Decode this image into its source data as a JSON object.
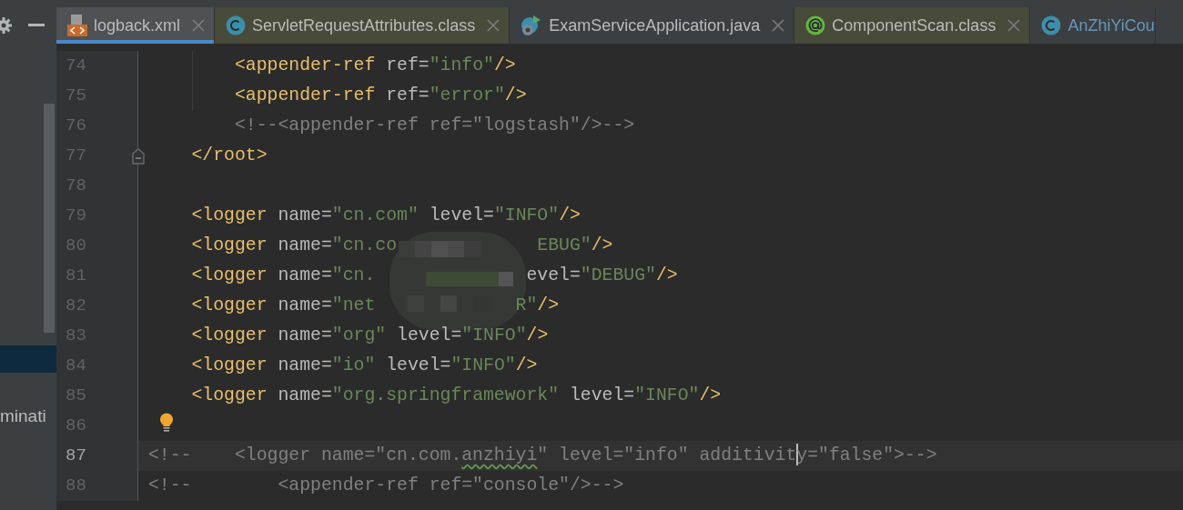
{
  "side_panel": {
    "selected_row": true,
    "label": "minati"
  },
  "tabs": [
    {
      "label": "logback.xml",
      "kind": "xml",
      "selected": true,
      "external": false,
      "vcs_modified": false
    },
    {
      "label": "ServletRequestAttributes.class",
      "kind": "class",
      "selected": false,
      "external": true,
      "vcs_modified": false
    },
    {
      "label": "ExamServiceApplication.java",
      "kind": "spring",
      "selected": false,
      "external": false,
      "vcs_modified": false
    },
    {
      "label": "ComponentScan.class",
      "kind": "annotation",
      "selected": false,
      "external": true,
      "vcs_modified": false
    },
    {
      "label": "AnZhiYiCou",
      "kind": "class",
      "selected": false,
      "external": false,
      "vcs_modified": true
    }
  ],
  "lines": [
    {
      "number": "74",
      "current": false,
      "guide": true,
      "tokens": [
        {
          "kind": "tag",
          "text": "        <appender-ref"
        },
        {
          "kind": "attr",
          "text": " ref="
        },
        {
          "kind": "str",
          "text": "\"info\""
        },
        {
          "kind": "tag",
          "text": "/>"
        }
      ]
    },
    {
      "number": "75",
      "current": false,
      "guide": true,
      "tokens": [
        {
          "kind": "tag",
          "text": "        <appender-ref"
        },
        {
          "kind": "attr",
          "text": " ref="
        },
        {
          "kind": "str",
          "text": "\"error\""
        },
        {
          "kind": "tag",
          "text": "/>"
        }
      ]
    },
    {
      "number": "76",
      "current": false,
      "tokens": [
        {
          "kind": "comment",
          "text": "        <!--<appender-ref ref=\"logstash\"/>-->"
        }
      ]
    },
    {
      "number": "77",
      "current": false,
      "fold_marker": true,
      "tokens": [
        {
          "kind": "tag",
          "text": "    </root>"
        }
      ]
    },
    {
      "number": "78",
      "current": false
    },
    {
      "number": "79",
      "current": false,
      "tokens": [
        {
          "kind": "tag",
          "text": "    <logger"
        },
        {
          "kind": "attr",
          "text": " name="
        },
        {
          "kind": "str",
          "text": "\"cn.com\""
        },
        {
          "kind": "attr",
          "text": " level="
        },
        {
          "kind": "str",
          "text": "\"INFO\""
        },
        {
          "kind": "tag",
          "text": "/>"
        }
      ]
    },
    {
      "number": "80",
      "current": false,
      "tokens": [
        {
          "kind": "tag",
          "text": "    <logger"
        },
        {
          "kind": "attr",
          "text": " name="
        },
        {
          "kind": "str",
          "text": "\"cn.co             EBUG\""
        },
        {
          "kind": "tag",
          "text": "/>"
        }
      ]
    },
    {
      "number": "81",
      "current": false,
      "tokens": [
        {
          "kind": "tag",
          "text": "    <logger"
        },
        {
          "kind": "attr",
          "text": " name="
        },
        {
          "kind": "str",
          "text": "\"cn."
        },
        {
          "kind": "attr",
          "text": "              evel="
        },
        {
          "kind": "str",
          "text": "\"DEBUG\""
        },
        {
          "kind": "tag",
          "text": "/>"
        }
      ]
    },
    {
      "number": "82",
      "current": false,
      "tokens": [
        {
          "kind": "tag",
          "text": "    <logger"
        },
        {
          "kind": "attr",
          "text": " name="
        },
        {
          "kind": "str",
          "text": "\"net             R\""
        },
        {
          "kind": "tag",
          "text": "/>"
        }
      ]
    },
    {
      "number": "83",
      "current": false,
      "tokens": [
        {
          "kind": "tag",
          "text": "    <logger"
        },
        {
          "kind": "attr",
          "text": " name="
        },
        {
          "kind": "str",
          "text": "\"org\""
        },
        {
          "kind": "attr",
          "text": " level="
        },
        {
          "kind": "str",
          "text": "\"INFO\""
        },
        {
          "kind": "tag",
          "text": "/>"
        }
      ]
    },
    {
      "number": "84",
      "current": false,
      "tokens": [
        {
          "kind": "tag",
          "text": "    <logger"
        },
        {
          "kind": "attr",
          "text": " name="
        },
        {
          "kind": "str",
          "text": "\"io\""
        },
        {
          "kind": "attr",
          "text": " level="
        },
        {
          "kind": "str",
          "text": "\"INFO\""
        },
        {
          "kind": "tag",
          "text": "/>"
        }
      ]
    },
    {
      "number": "85",
      "current": false,
      "tokens": [
        {
          "kind": "tag",
          "text": "    <logger"
        },
        {
          "kind": "attr",
          "text": " name="
        },
        {
          "kind": "str",
          "text": "\"org.springframework\""
        },
        {
          "kind": "attr",
          "text": " level="
        },
        {
          "kind": "str",
          "text": "\"INFO\""
        },
        {
          "kind": "tag",
          "text": "/>"
        }
      ]
    },
    {
      "number": "86",
      "current": false,
      "bulb": true
    },
    {
      "number": "87",
      "current": true,
      "tokens": [
        {
          "kind": "comment",
          "text": "<!--    <logger name=\"cn.com."
        },
        {
          "kind": "typo",
          "text": "anzhiyi"
        },
        {
          "kind": "comment",
          "text": "\" level=\"info\" additivit"
        },
        {
          "kind": "comment",
          "caret_before": true,
          "text": "y=\"false\">-->"
        }
      ]
    },
    {
      "number": "88",
      "current": false,
      "tokens": [
        {
          "kind": "comment",
          "text": "<!--        <appender-ref ref=\"console\"/>-->"
        }
      ]
    }
  ]
}
